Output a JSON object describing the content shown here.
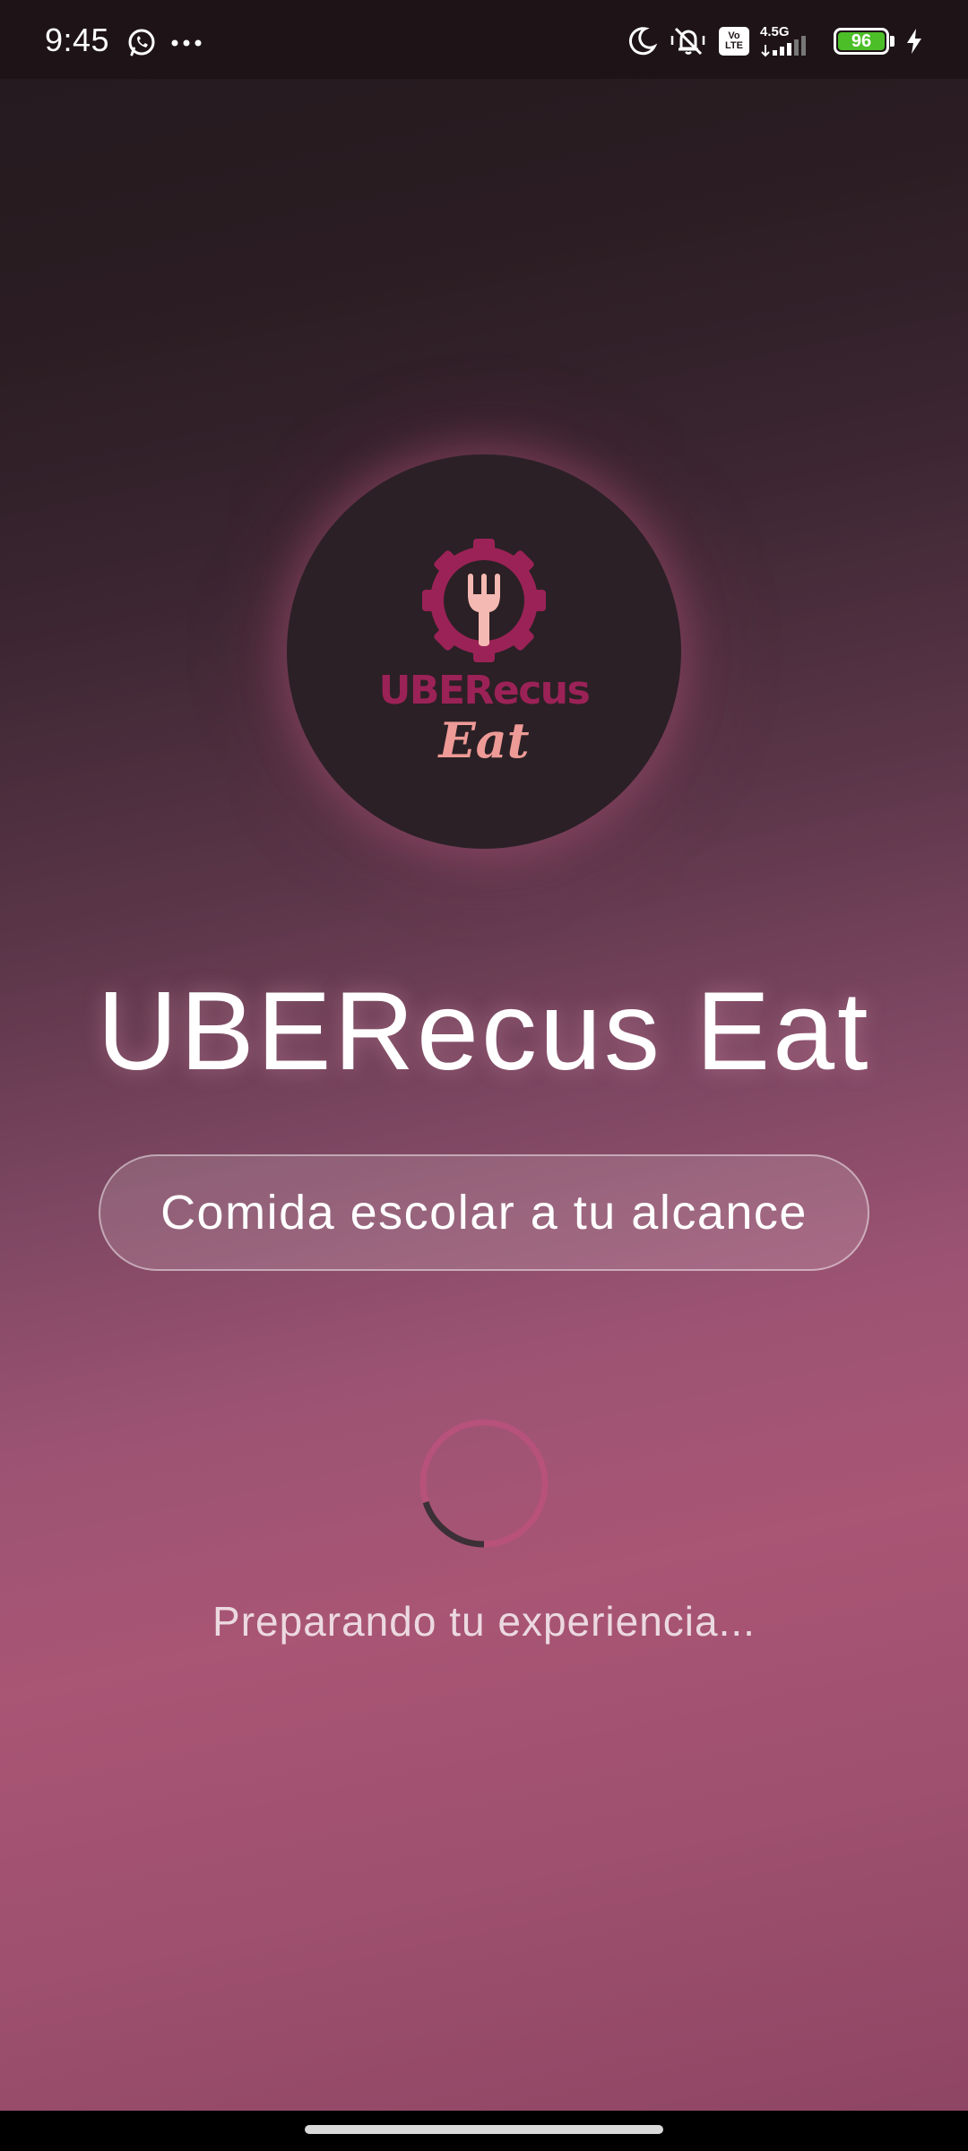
{
  "status_bar": {
    "time": "9:45",
    "network_type": "4.5G",
    "volte_label_top": "Vo",
    "volte_label_bottom": "LTE",
    "battery_level": "96",
    "icons": [
      "whatsapp-icon",
      "more-dots-icon",
      "moon-icon",
      "mute-vibrate-icon",
      "volte-icon",
      "signal-icon",
      "battery-icon",
      "charging-icon"
    ]
  },
  "logo": {
    "brand_line1": "UBERecus",
    "brand_line2": "Eat",
    "icon": "gear-fork-icon",
    "colors": {
      "gear": "#9b2257",
      "fork": "#f4b9b2",
      "wordmark": "#9b2257",
      "script": "#ee9a96"
    }
  },
  "app": {
    "title": "UBERecus Eat",
    "tagline": "Comida escolar a tu alcance",
    "loading_text": "Preparando tu experiencia..."
  },
  "colors": {
    "status_bar_bg": "#1e1418",
    "circle_bg": "#2b2025",
    "gradient_top": "#231a1e",
    "gradient_mid": "#a95574",
    "gradient_bottom": "#8c4462",
    "battery_fill": "#4cbe28"
  }
}
